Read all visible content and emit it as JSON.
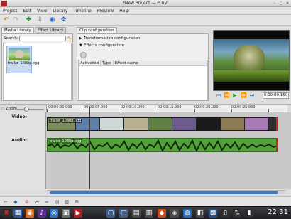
{
  "window": {
    "title": "*New Project — PiTiVi"
  },
  "menubar": {
    "items": [
      "Project",
      "Edit",
      "View",
      "Library",
      "Timeline",
      "Preview",
      "Help"
    ]
  },
  "library": {
    "tabs": [
      "Media Library",
      "Effect Library"
    ],
    "search_label": "Search:",
    "search_value": "",
    "items": [
      {
        "name": "trailer_1080p.ogg"
      }
    ]
  },
  "clip_config": {
    "tab": "Clip configuration",
    "transformation": "Transformation configuration",
    "effects": "Effects configuration",
    "columns": [
      "Activated",
      "Type",
      "Effect name"
    ]
  },
  "viewer": {
    "time": "0:00:00.150"
  },
  "timeline": {
    "zoom_label": "Zoom",
    "ruler_labels": [
      "00:00:00.000",
      "00:00:05.000",
      "00:00:10.000",
      "00:00:15.000",
      "00:00:20.000",
      "00:00:25.000"
    ],
    "tracks": [
      {
        "label": "Video:",
        "clip": "trailer_1080p.ogg"
      },
      {
        "label": "Audio:",
        "clip": "trailer_1080p.ogg"
      }
    ]
  },
  "taskbar": {
    "clock": "22:31"
  },
  "colors": {
    "audio_clip": "#53a13a",
    "accent": "#3d79c9",
    "playhead_red": "#d82020"
  }
}
